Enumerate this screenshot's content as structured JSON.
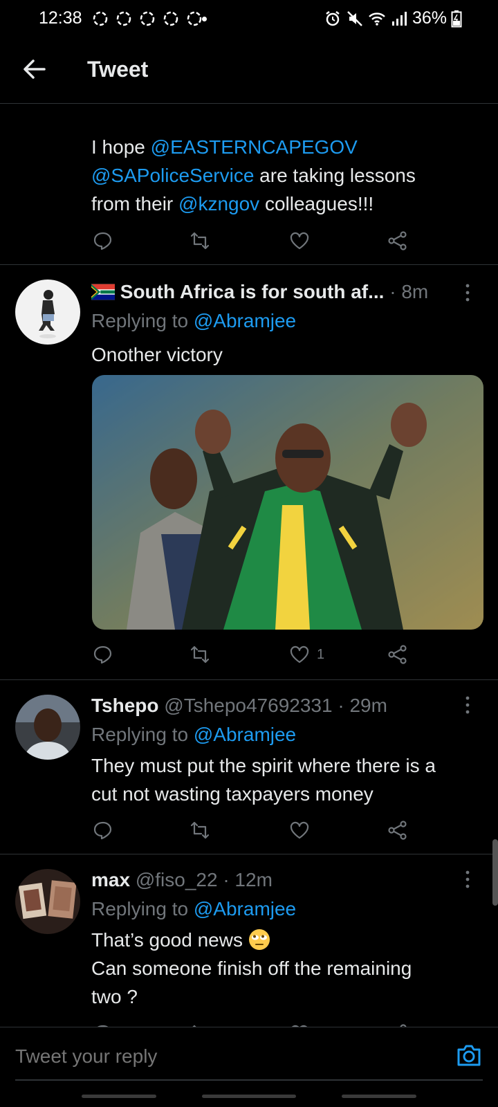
{
  "status_bar": {
    "time": "12:38",
    "battery": "36%"
  },
  "header": {
    "title": "Tweet"
  },
  "tweets": [
    {
      "text_parts": [
        "I hope ",
        "@EASTERNCAPEGOV",
        "@SAPoliceService",
        " are taking lessons",
        "from their ",
        "@kzngov",
        " colleagues!!!"
      ]
    },
    {
      "name": "South Africa is for south af...",
      "handle": "",
      "time": "· 8m",
      "reply_prefix": "Replying to ",
      "reply_handle": "@Abramjee",
      "text": "Onother victory",
      "like_count": "1"
    },
    {
      "name": "Tshepo",
      "handle": "@Tshepo47692331",
      "time": "· 29m",
      "reply_prefix": "Replying to ",
      "reply_handle": "@Abramjee",
      "text_line1": "They must put the spirit where there is a",
      "text_line2": "cut not wasting taxpayers money"
    },
    {
      "name": "max",
      "handle": "@fiso_22",
      "time": "· 12m",
      "reply_prefix": "Replying to ",
      "reply_handle": "@Abramjee",
      "text_line1": "That’s good news ",
      "text_line2": "Can someone finish off the remaining",
      "text_line3": "two ?"
    }
  ],
  "reply_bar": {
    "placeholder": "Tweet your reply"
  },
  "icons": [
    "back-arrow-icon",
    "reply-icon",
    "retweet-icon",
    "like-icon",
    "share-icon",
    "more-icon",
    "camera-icon",
    "flag-icon",
    "eyes-emoji-icon"
  ],
  "colors": {
    "accent": "#1d9bf0",
    "secondary_text": "#71767b",
    "background": "#000000"
  }
}
